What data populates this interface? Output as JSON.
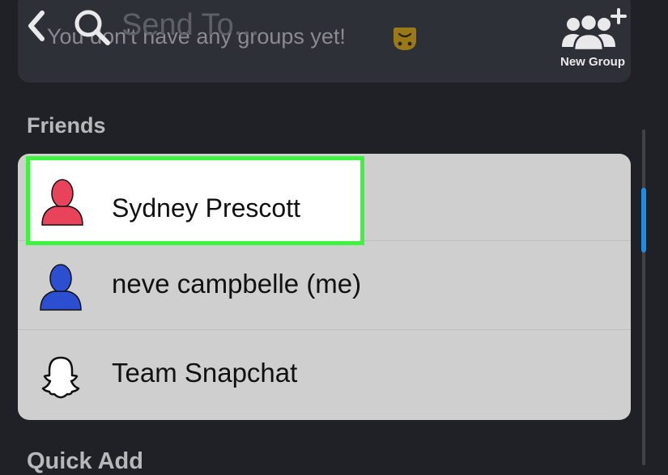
{
  "header": {
    "title": "Send To...",
    "back_icon": "chevron-left-icon",
    "search_icon": "search-icon"
  },
  "groups": {
    "empty_text": "You don't have any groups yet!",
    "emoji_icon": "upside-down-face-emoji",
    "new_group_label": "New Group",
    "new_group_icon": "add-group-icon"
  },
  "friends": {
    "heading": "Friends",
    "items": [
      {
        "label": "Sydney Prescott",
        "avatar": "person-icon",
        "avatar_color": "#e8435a",
        "highlighted": true
      },
      {
        "label": "neve campbelle (me)",
        "avatar": "person-icon",
        "avatar_color": "#2b4fd0",
        "highlighted": false
      },
      {
        "label": "Team Snapchat",
        "avatar": "snapchat-ghost-icon",
        "avatar_color": "#ffffff",
        "highlighted": false
      }
    ]
  },
  "quick_add": {
    "heading": "Quick Add"
  },
  "colors": {
    "background": "#1f2126",
    "card": "#2e3037",
    "list_background": "#cfcfcf",
    "highlight_border": "#3bf43b",
    "scroll_thumb": "#1f8de6"
  }
}
